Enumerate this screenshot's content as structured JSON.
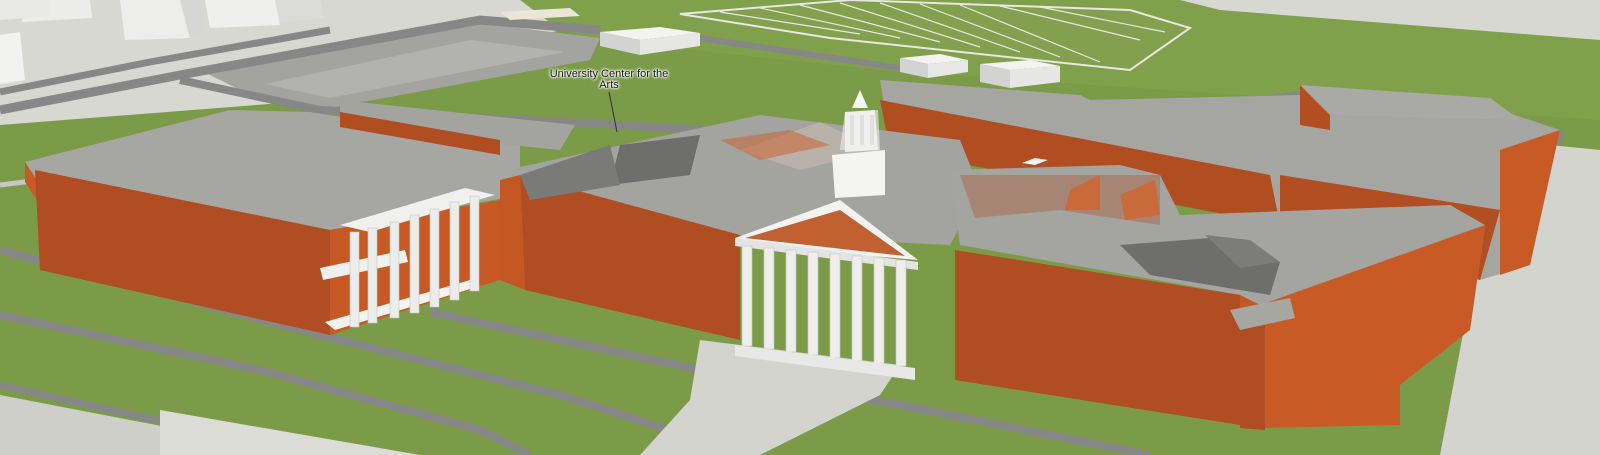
{
  "map": {
    "style": "3D satellite-hybrid campus view",
    "poi_label_line1": "University Center for the",
    "poi_label_line2": "Arts",
    "colors": {
      "grass": "#7a9a4a",
      "road": "#8a8a8a",
      "sidewalk": "#d4d4cf",
      "brick": "#b04d22",
      "roof": "#a3a3a0",
      "column": "#ebebeb"
    },
    "icons": [
      "football-field",
      "cupola"
    ]
  }
}
